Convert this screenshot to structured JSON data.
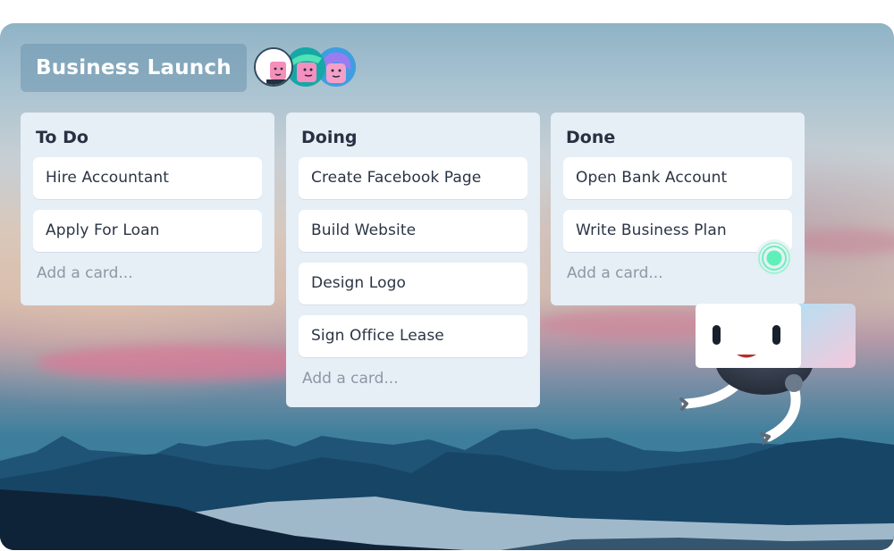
{
  "board": {
    "title": "Business Launch",
    "members": [
      {
        "name": "member-1",
        "ring": "#324a5f",
        "hair": "#ffffff",
        "bg": "#ffffff"
      },
      {
        "name": "member-2",
        "ring": "#16a3a3",
        "hair": "#48d9b0",
        "bg": "#1fb3b0"
      },
      {
        "name": "member-3",
        "ring": "#3b8fd1",
        "hair": "#8a7cf0",
        "bg": "#4aa3e0"
      }
    ]
  },
  "lists": [
    {
      "title": "To Do",
      "cards": [
        "Hire Accountant",
        "Apply For Loan"
      ],
      "add_card": "Add a card..."
    },
    {
      "title": "Doing",
      "cards": [
        "Create Facebook Page",
        "Build Website",
        "Design Logo",
        "Sign Office Lease"
      ],
      "add_card": "Add a card..."
    },
    {
      "title": "Done",
      "cards": [
        "Open Bank Account",
        "Write Business Plan"
      ],
      "add_card": "Add a card..."
    }
  ],
  "colors": {
    "list_bg": "#e6eef6",
    "card_bg": "#ffffff",
    "card_text": "#2b3445",
    "add_card_text": "#8e97a4",
    "drag_indicator": "#5ef0b8"
  }
}
